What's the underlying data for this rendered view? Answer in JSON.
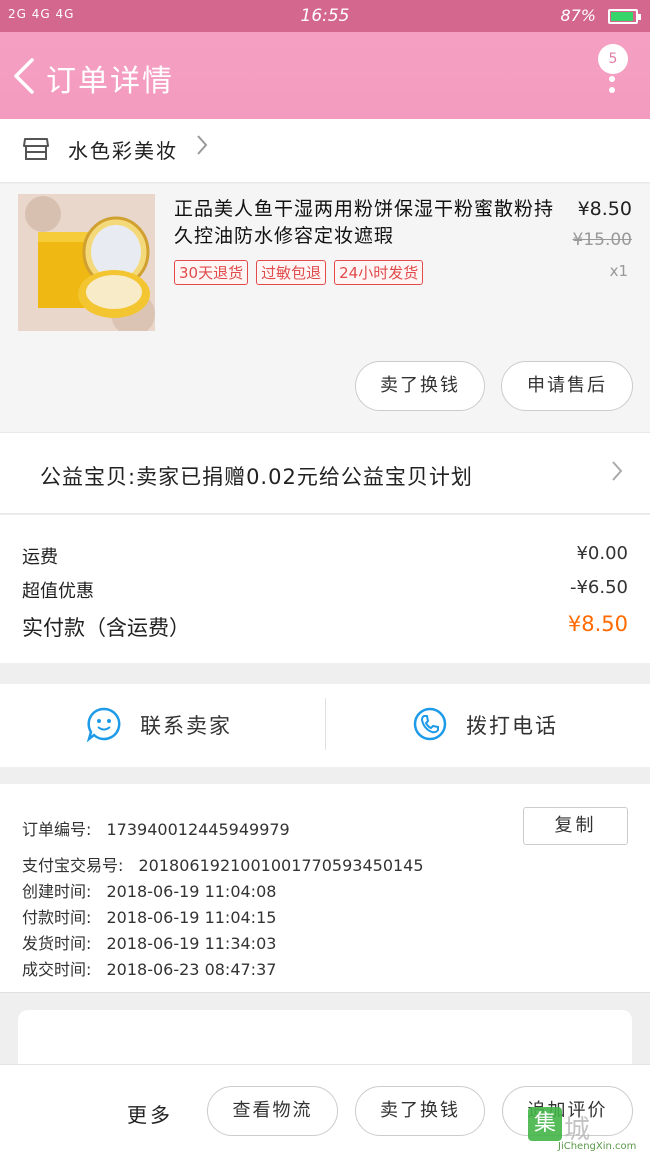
{
  "status_bar": {
    "signal": "2G 4G 4G",
    "time": "16:55",
    "battery": "87%"
  },
  "header": {
    "title": "订单详情",
    "badge_count": "5"
  },
  "shop": {
    "name": "水色彩美妆"
  },
  "product": {
    "name": "正品美人鱼干湿两用粉饼保湿干粉蜜散粉持久控油防水修容定妆遮瑕",
    "price": "¥8.50",
    "original_price": "¥15.00",
    "quantity": "x1",
    "tags": [
      "30天退货",
      "过敏包退",
      "24小时发货"
    ],
    "buttons": {
      "resell": "卖了换钱",
      "after_sale": "申请售后"
    }
  },
  "charity": {
    "text": "公益宝贝:卖家已捐赠0.02元给公益宝贝计划"
  },
  "fees": {
    "shipping_label": "运费",
    "shipping_value": "¥0.00",
    "discount_label": "超值优惠",
    "discount_value": "-¥6.50",
    "total_label": "实付款（含运费）",
    "total_value": "¥8.50"
  },
  "contact": {
    "seller_label": "联系卖家",
    "phone_label": "拨打电话"
  },
  "order_info": {
    "order_no_label": "订单编号:",
    "order_no": "173940012445949979",
    "copy_label": "复制",
    "alipay_label": "支付宝交易号:",
    "alipay_no": "2018061921001001770593450145",
    "created_label": "创建时间:",
    "created": "2018-06-19 11:04:08",
    "paid_label": "付款时间:",
    "paid": "2018-06-19 11:04:15",
    "shipped_label": "发货时间:",
    "shipped": "2018-06-19 11:34:03",
    "completed_label": "成交时间:",
    "completed": "2018-06-23 08:47:37"
  },
  "bottom_bar": {
    "more": "更多",
    "logistics": "查看物流",
    "resell": "卖了换钱",
    "review": "追加评价"
  },
  "watermark": {
    "logo_char": "集",
    "text": "城",
    "url": "JiChengXin.com"
  },
  "colors": {
    "header_pink": "#f39bbf",
    "status_pink": "#d4678e",
    "accent_orange": "#ff6a00",
    "tag_red": "#e14b4b",
    "icon_blue": "#1e9be8"
  }
}
